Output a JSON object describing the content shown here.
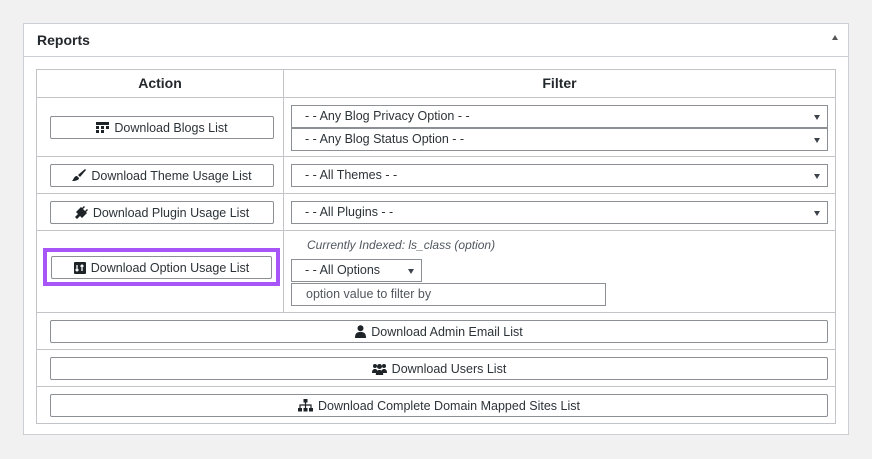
{
  "panel": {
    "title": "Reports",
    "toggle_icon": "caret-up-icon"
  },
  "table": {
    "headers": {
      "action": "Action",
      "filter": "Filter"
    }
  },
  "rows": {
    "blogs": {
      "button_label": "Download Blogs List",
      "icon": "table-grid-icon",
      "privacy_select": "- - Any Blog Privacy Option - -",
      "status_select": "- - Any Blog Status Option - -"
    },
    "themes": {
      "button_label": "Download Theme Usage List",
      "icon": "paintbrush-icon",
      "select": "- - All Themes - -"
    },
    "plugins": {
      "button_label": "Download Plugin Usage List",
      "icon": "plug-icon",
      "select": "- - All Plugins - -"
    },
    "options": {
      "button_label": "Download Option Usage List",
      "icon": "sort-icon",
      "indexed_note": "Currently Indexed: ls_class (option)",
      "select": "- - All Options",
      "value_placeholder": "option value to filter by",
      "highlight_color": "#a855f7"
    },
    "admin_email": {
      "button_label": "Download Admin Email List",
      "icon": "user-icon"
    },
    "users": {
      "button_label": "Download Users List",
      "icon": "users-group-icon"
    },
    "domain_mapped": {
      "button_label": "Download Complete Domain Mapped Sites List",
      "icon": "sitemap-icon"
    }
  }
}
